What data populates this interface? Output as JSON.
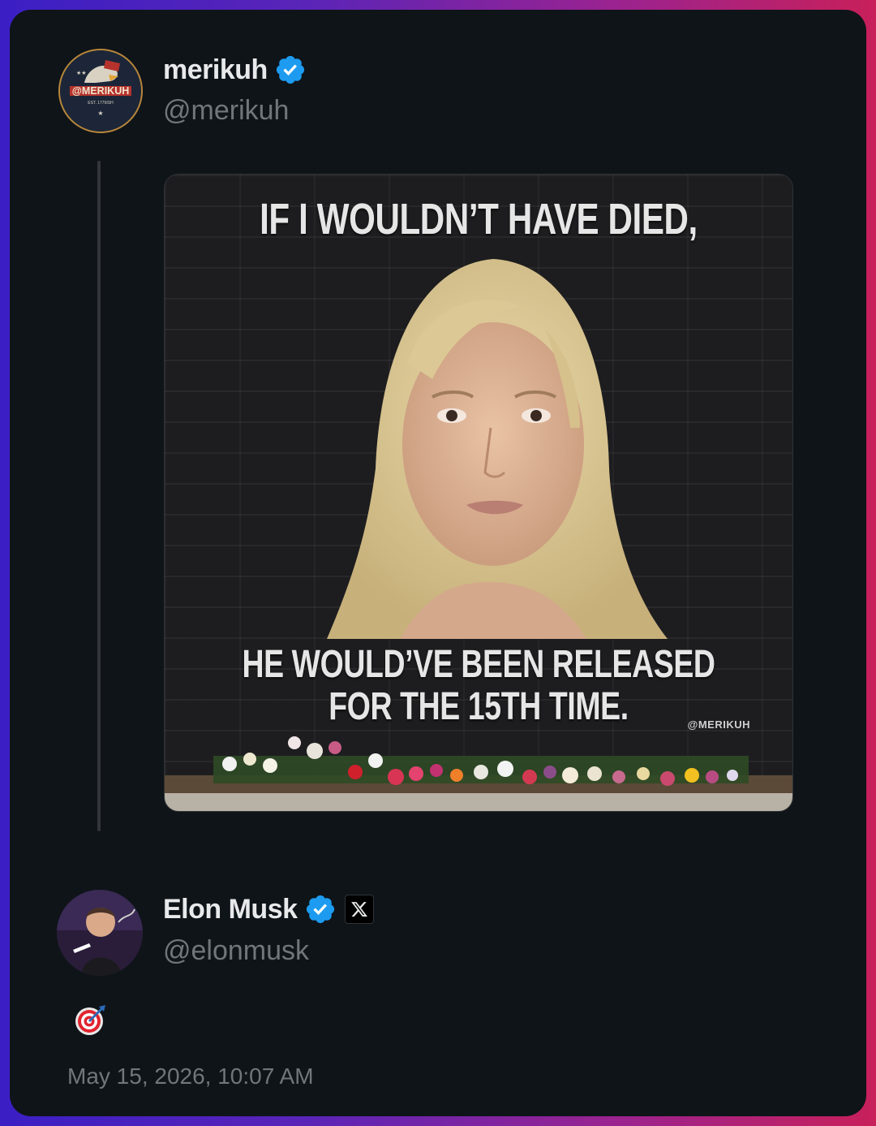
{
  "original_post": {
    "display_name": "merikuh",
    "handle": "@merikuh",
    "avatar_text": "@MERIKUH",
    "avatar_subtext": "EST. 1776ISH",
    "media": {
      "top_text": "IF I WOULDN’T HAVE DIED,",
      "bottom_text_line1": "HE WOULD’VE BEEN RELEASED",
      "bottom_text_line2": "FOR THE 15TH TIME.",
      "watermark": "@MERIKUH"
    }
  },
  "reply": {
    "display_name": "Elon Musk",
    "handle": "@elonmusk",
    "body_emoji": "direct-hit-target-icon",
    "timestamp": "May 15, 2026, 10:07 AM"
  },
  "colors": {
    "card_background": "#0f1419",
    "primary_text": "#e7e9ea",
    "secondary_text": "#71767b",
    "verified_blue": "#1d9bf0",
    "thread_line": "#333639"
  }
}
